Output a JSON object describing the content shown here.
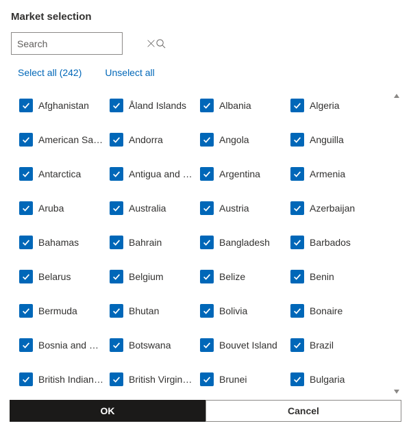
{
  "title": "Market selection",
  "search": {
    "placeholder": "Search",
    "value": ""
  },
  "actions": {
    "select_all": "Select all (242)",
    "unselect_all": "Unselect all"
  },
  "total_count": 242,
  "markets": [
    {
      "label": "Afghanistan",
      "checked": true
    },
    {
      "label": "Åland Islands",
      "checked": true
    },
    {
      "label": "Albania",
      "checked": true
    },
    {
      "label": "Algeria",
      "checked": true
    },
    {
      "label": "American Samoa",
      "checked": true
    },
    {
      "label": "Andorra",
      "checked": true
    },
    {
      "label": "Angola",
      "checked": true
    },
    {
      "label": "Anguilla",
      "checked": true
    },
    {
      "label": "Antarctica",
      "checked": true
    },
    {
      "label": "Antigua and Barbuda",
      "checked": true
    },
    {
      "label": "Argentina",
      "checked": true
    },
    {
      "label": "Armenia",
      "checked": true
    },
    {
      "label": "Aruba",
      "checked": true
    },
    {
      "label": "Australia",
      "checked": true
    },
    {
      "label": "Austria",
      "checked": true
    },
    {
      "label": "Azerbaijan",
      "checked": true
    },
    {
      "label": "Bahamas",
      "checked": true
    },
    {
      "label": "Bahrain",
      "checked": true
    },
    {
      "label": "Bangladesh",
      "checked": true
    },
    {
      "label": "Barbados",
      "checked": true
    },
    {
      "label": "Belarus",
      "checked": true
    },
    {
      "label": "Belgium",
      "checked": true
    },
    {
      "label": "Belize",
      "checked": true
    },
    {
      "label": "Benin",
      "checked": true
    },
    {
      "label": "Bermuda",
      "checked": true
    },
    {
      "label": "Bhutan",
      "checked": true
    },
    {
      "label": "Bolivia",
      "checked": true
    },
    {
      "label": "Bonaire",
      "checked": true
    },
    {
      "label": "Bosnia and Herzegovina",
      "checked": true
    },
    {
      "label": "Botswana",
      "checked": true
    },
    {
      "label": "Bouvet Island",
      "checked": true
    },
    {
      "label": "Brazil",
      "checked": true
    },
    {
      "label": "British Indian Ocean Territory",
      "checked": true
    },
    {
      "label": "British Virgin Islands",
      "checked": true
    },
    {
      "label": "Brunei",
      "checked": true
    },
    {
      "label": "Bulgaria",
      "checked": true
    }
  ],
  "footer": {
    "ok": "OK",
    "cancel": "Cancel"
  },
  "icons": {
    "clear": "clear-icon",
    "search": "search-icon",
    "check": "check-icon"
  },
  "colors": {
    "accent": "#0067b8",
    "button_primary_bg": "#1b1a19"
  }
}
